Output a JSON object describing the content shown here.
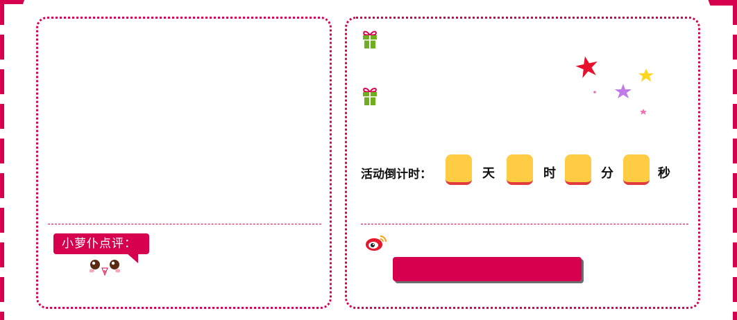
{
  "review": {
    "badge_label": "小萝仆点评："
  },
  "countdown": {
    "label": "活动倒计时：",
    "units": {
      "day": "天",
      "hour": "时",
      "minute": "分",
      "second": "秒"
    },
    "values": {
      "day": "",
      "hour": "",
      "minute": "",
      "second": ""
    }
  },
  "share": {
    "button_label": ""
  },
  "icons": {
    "gift": "gift-icon",
    "stars": "stars-decoration",
    "weibo": "weibo-icon",
    "face": "cute-face-icon"
  },
  "colors": {
    "accent": "#d6004f",
    "countdown_box": "#ffcc44",
    "countdown_box_border": "#e23b3b",
    "gift_green": "#6fae1e"
  }
}
